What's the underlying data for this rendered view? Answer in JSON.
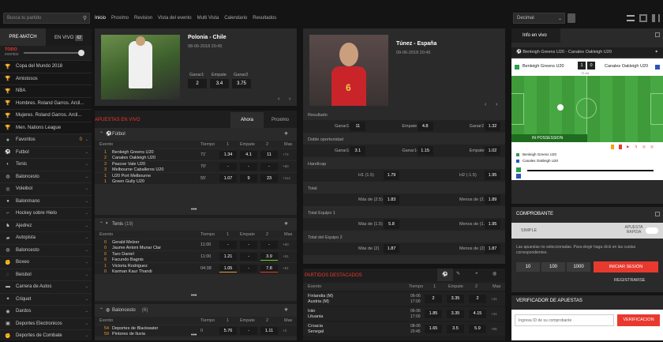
{
  "search": {
    "placeholder": "Busca tu partido"
  },
  "nav": [
    "Inicio",
    "Proximo",
    "Revision",
    "Vista del evento",
    "Multi Vista",
    "Calendario",
    "Resultados"
  ],
  "odds_format": "Decimal",
  "sidebar": {
    "tab_prematch": "PRE-MATCH",
    "tab_live": "EN VIVO",
    "live_count": "62",
    "todo": "TODO",
    "eventos": "eventos",
    "items": [
      {
        "label": "Copa del Mundo 2018",
        "icon": "trophy-icon"
      },
      {
        "label": "Amistosos",
        "icon": "trophy-icon"
      },
      {
        "label": "NBA",
        "icon": "trophy-icon"
      },
      {
        "label": "Hombres. Roland Garros. Arcil...",
        "icon": "trophy-icon"
      },
      {
        "label": "Mujeres. Roland Garros. Arcil...",
        "icon": "trophy-icon"
      },
      {
        "label": "Men. Nations League",
        "icon": "trophy-icon"
      },
      {
        "label": "Favoritos",
        "icon": "star-icon",
        "count": "0"
      },
      {
        "label": "Futbol",
        "icon": "soccer-ball-icon"
      },
      {
        "label": "Tenis",
        "icon": "tennis-icon"
      },
      {
        "label": "Baloncesto",
        "icon": "basketball-icon"
      },
      {
        "label": "Voleibol",
        "icon": "volleyball-icon"
      },
      {
        "label": "Balonmano",
        "icon": "handball-icon"
      },
      {
        "label": "Hockey sobre Hielo",
        "icon": "hockey-icon"
      },
      {
        "label": "Ajedrez",
        "icon": "chess-icon"
      },
      {
        "label": "Autopista",
        "icon": "car-icon"
      },
      {
        "label": "Baloncesto",
        "icon": "basketball-icon"
      },
      {
        "label": "Boxeo",
        "icon": "boxing-icon"
      },
      {
        "label": "Beisbol",
        "icon": "baseball-icon"
      },
      {
        "label": "Carrera de Autos",
        "icon": "racecar-icon"
      },
      {
        "label": "Criquet",
        "icon": "cricket-icon"
      },
      {
        "label": "Dardos",
        "icon": "darts-icon"
      },
      {
        "label": "Deportes Electronicos",
        "icon": "gamepad-icon"
      },
      {
        "label": "Deportes de Combate",
        "icon": "fist-icon"
      }
    ]
  },
  "featured1": {
    "title": "Polonia - Chile",
    "date": "08-06-2018 20:45",
    "h1": "Ganar1",
    "h2": "Empate",
    "h3": "Ganar2",
    "o1": "2",
    "o2": "3.4",
    "o3": "3.75"
  },
  "featured2": {
    "title": "Túnez - España",
    "date": "09-06-2018 20:45"
  },
  "live": {
    "title": "APUESTAS EN VIVO",
    "tab_now": "Ahora",
    "tab_next": "Proximo",
    "football": "Fútbol",
    "tennis": "Tenis",
    "tennis_count": "(19)",
    "basket": "Baloncesto",
    "basket_count": "(6)",
    "cols": {
      "event": "Evento",
      "time": "Tiempo",
      "c1": "1",
      "cx": "Empate",
      "c2": "2",
      "more": "Mas"
    },
    "football_rows": [
      {
        "s1": "1",
        "s2": "2",
        "t1": "Benleigh Greens U20",
        "t2": "Canales Oakleigh U20",
        "time": "71'",
        "o1": "1.34",
        "ox": "4.1",
        "o2": "11",
        "more": "+72"
      },
      {
        "s1": "3",
        "s2": "3",
        "t1": "Pascoe Vale U20",
        "t2": "Melbourne Caballeros U20",
        "time": "70'",
        "o1": "-",
        "ox": "-",
        "o2": "-",
        "more": "+60"
      },
      {
        "s1": "1",
        "s2": "1",
        "t1": "U20 Port Melbourne",
        "t2": "Green Gully U20",
        "time": "55'",
        "o1": "1.07",
        "ox": "9",
        "o2": "23",
        "more": "+114"
      }
    ],
    "tennis_rows": [
      {
        "s1": "0",
        "s2": "0",
        "t1": "Gerald Melzer",
        "t2": "Jaume Antoni Munar Clar",
        "time": "11:00",
        "o1": "-",
        "ox": "-",
        "o2": "-",
        "more": "+60"
      },
      {
        "s1": "0",
        "s2": "0",
        "t1": "Taro Daniel",
        "t2": "Facundo Bagnis",
        "time": "11:00",
        "o1": "1.21",
        "ox": "-",
        "o2": "3.9",
        "more": "+51"
      },
      {
        "s1": "1",
        "s2": "0",
        "t1": "Victoria Rodriguez",
        "t2": "Karman Kaur Thandi",
        "time": "04:38",
        "o1": "1.05",
        "ox": "-",
        "o2": "7.8",
        "more": "+51"
      }
    ],
    "basket_rows": [
      {
        "s1": "54",
        "s2": "59",
        "t1": "Deportes de Blackwater",
        "t2": "Pintores de lluvia",
        "time": "II",
        "o1": "5.76",
        "ox": "-",
        "o2": "1.11",
        "more": "+2"
      }
    ]
  },
  "markets": {
    "resultado": "Resultado",
    "g1": "Ganar1",
    "g1o": "11",
    "emp": "Empate",
    "empo": "4.8",
    "g2": "Ganar2",
    "g2o": "1.32",
    "doble": "Doble oportunidad",
    "d1": "Ganar1-Empate",
    "d1o": "3.1",
    "d2": "Ganar1-Ganar2",
    "d2o": "1.15",
    "d3": "Empate-Ganar2",
    "d3o": "1.02",
    "handicap": "Handicap",
    "h1": "H1 (1.5)",
    "h1o": "1.79",
    "h2": "H2 (-1.5)",
    "h2o": "1.95",
    "total": "Total",
    "tm": "Más de (2.5)",
    "tmo": "1.83",
    "tl": "Menos de (2.5)",
    "tlo": "1.89",
    "total1": "Total Equipo 1",
    "t1m": "Más de (1.5)",
    "t1mo": "5.8",
    "t1l": "Menos de (1.5)",
    "t1lo": "1.95",
    "total2": "Total del Equipo 2",
    "t2m": "Más de (2)",
    "t2mo": "1.87",
    "t2l": "Menos de (2)",
    "t2lo": "1.87"
  },
  "destacados": {
    "title": "PARTIDOS DESTACADOS",
    "rows": [
      {
        "t1": "Finlandia (M)",
        "t2": "Austria (M)",
        "date": "06-06",
        "time": "17:00",
        "o1": "2",
        "ox": "3.35",
        "o2": "2",
        "more": "+41"
      },
      {
        "t1": "Irán",
        "t2": "Lituania",
        "date": "06-06",
        "time": "17:00",
        "o1": "1.85",
        "ox": "3.35",
        "o2": "4.15",
        "more": "+41"
      },
      {
        "t1": "Croacia",
        "t2": "Senegal",
        "date": "08-06",
        "time": "20:45",
        "o1": "1.65",
        "ox": "3.5",
        "o2": "5.9",
        "more": "+95"
      }
    ]
  },
  "live_info": {
    "title": "Info en vivo",
    "match": "Benleigh Greens U20 - Canales Oakleigh U20",
    "home": "Benleigh Greens U20",
    "away": "Canales Oakleigh U20",
    "score_h": "1",
    "score_a": "0",
    "clock": "71:44",
    "possession": "IN POSSESSION",
    "stat_h": "Benleigh Greens U20",
    "stat_a": "Canales Oakleigh U20"
  },
  "betslip": {
    "title": "COMPROBANTE",
    "simple": "SIMPLE",
    "quick": "APUESTA RAPIDA",
    "msg": "Las apuestas no seleccionadas. Para elegir haga click en las cuotas correspondientes.",
    "a1": "10",
    "a2": "100",
    "a3": "1000",
    "login": "INICIAR SESIÓN",
    "register": "REGISTRARSE"
  },
  "verifier": {
    "title": "VERIFICADOR DE APUESTAS",
    "placeholder": "Ingresa ID de su comprobante",
    "button": "VERIFICACION"
  },
  "colors": {
    "accent": "#e8392f",
    "green": "#6fcf2f",
    "orange": "#e89b2f"
  }
}
